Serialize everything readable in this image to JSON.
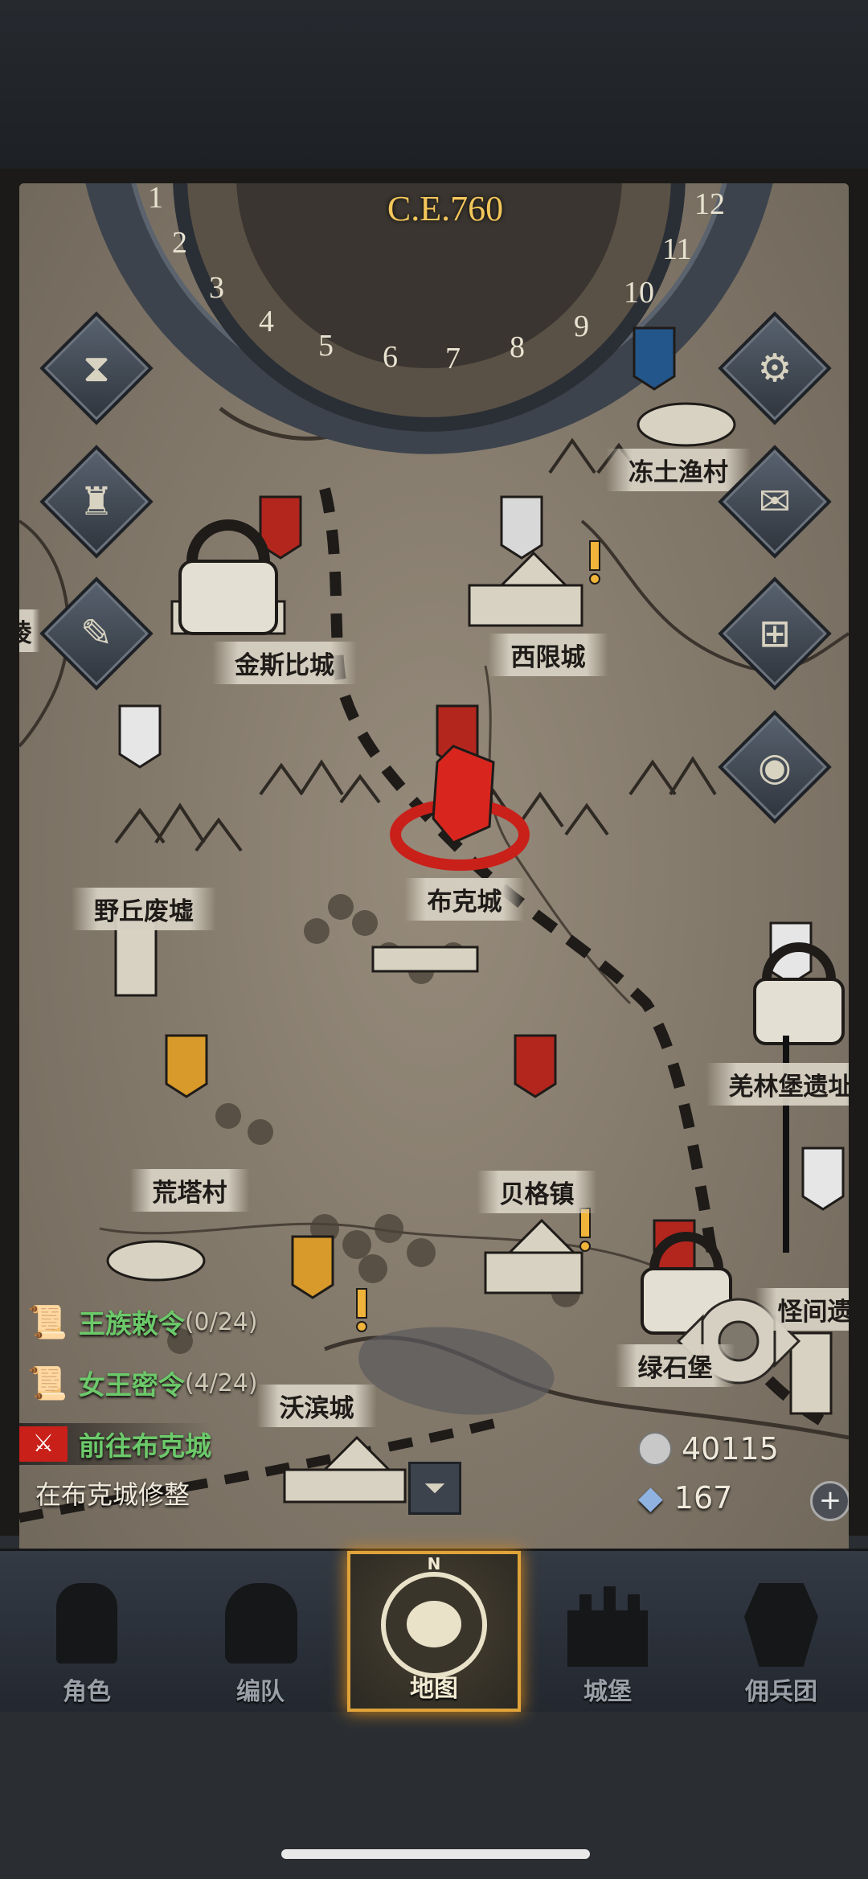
{
  "map": {
    "era": "C.E.760",
    "dial_numbers": [
      "1",
      "2",
      "3",
      "4",
      "5",
      "6",
      "7",
      "8",
      "9",
      "10",
      "11",
      "12"
    ],
    "locations": [
      {
        "id": "kingsby",
        "name": "金斯比城"
      },
      {
        "id": "xixian",
        "name": "西限城"
      },
      {
        "id": "dongtu",
        "name": "冻土渔村"
      },
      {
        "id": "yeqiu",
        "name": "野丘废墟"
      },
      {
        "id": "buke",
        "name": "布克城"
      },
      {
        "id": "qianglin",
        "name": "羌林堡遗址"
      },
      {
        "id": "huangta",
        "name": "荒塔村"
      },
      {
        "id": "beige",
        "name": "贝格镇"
      },
      {
        "id": "woobin",
        "name": "沃滨城"
      },
      {
        "id": "lvshi",
        "name": "绿石堡"
      },
      {
        "id": "guaijian",
        "name": "怪间遗"
      },
      {
        "id": "left_edge",
        "name": "陵"
      }
    ]
  },
  "side_buttons": {
    "left": [
      {
        "icon": "hourglass-icon"
      },
      {
        "icon": "money-bag-icon"
      },
      {
        "icon": "scroll-icon"
      }
    ],
    "right": [
      {
        "icon": "gear-icon"
      },
      {
        "icon": "mail-icon"
      },
      {
        "icon": "inventory-grid-icon"
      },
      {
        "icon": "coin-icon"
      }
    ]
  },
  "quests": [
    {
      "title": "王族敕令",
      "count": "(0/24)",
      "icon": "scroll-icon"
    },
    {
      "title": "女王密令",
      "count": "(4/24)",
      "icon": "scroll-icon"
    },
    {
      "title": "前往布克城",
      "count": "",
      "icon": "crossed-swords-icon"
    }
  ],
  "status_text": "在布克城修整",
  "resources": {
    "silver": "40115",
    "crystal": "167"
  },
  "nav": {
    "tabs": [
      {
        "label": "角色",
        "icon": "knight-icon",
        "active": false
      },
      {
        "label": "编队",
        "icon": "helmet-icon",
        "active": false
      },
      {
        "label": "地图",
        "icon": "compass-map-icon",
        "active": true
      },
      {
        "label": "城堡",
        "icon": "castle-icon",
        "active": false
      },
      {
        "label": "佣兵团",
        "icon": "mercenary-icon",
        "active": false
      }
    ],
    "compass_letter": "N"
  },
  "colors": {
    "accent_gold": "#e0a33a",
    "quest_green": "#6cc96a",
    "banner_red": "#b3261e"
  }
}
